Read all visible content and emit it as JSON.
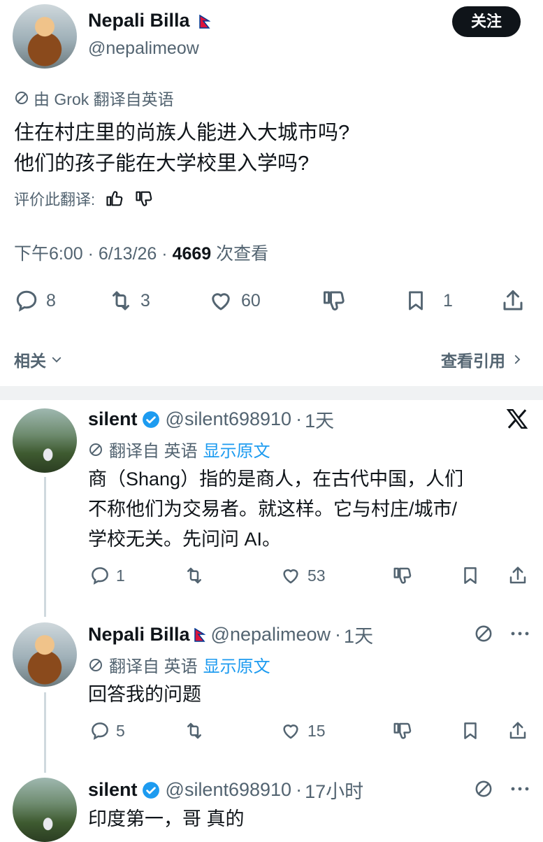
{
  "main_tweet": {
    "author_name": "Nepali Billa",
    "author_handle": "@nepalimeow",
    "follow_label": "关注",
    "translation_note": "由 Grok 翻译自英语",
    "body_line1": "住在村庄里的尚族人能进入大城市吗?",
    "body_line2": "他们的孩子能在大学校里入学吗?",
    "rate_translation": "评价此翻译:",
    "time": "下午6:00",
    "date": "6/13/26",
    "views": "4669",
    "views_label": "次查看",
    "replies": "8",
    "retweets": "3",
    "likes": "60",
    "bookmarks": "1"
  },
  "related_label": "相关",
  "view_quotes_label": "查看引用",
  "replies": [
    {
      "name": "silent",
      "handle": "@silent698910",
      "time": "1天",
      "translated_from": "翻译自 英语",
      "show_original": "显示原文",
      "body_lines": [
        "商（Shang）指的是商人，在古代中国，人们",
        "不称他们为交易者。就这样。它与村庄/城市/",
        "学校无关。先问问 AI。"
      ],
      "reply_count": "1",
      "retweet_count": "",
      "like_count": "53"
    },
    {
      "name": "Nepali Billa",
      "handle": "@nepalimeow",
      "time": "1天",
      "translated_from": "翻译自 英语",
      "show_original": "显示原文",
      "body_lines": [
        "回答我的问题"
      ],
      "reply_count": "5",
      "retweet_count": "",
      "like_count": "15"
    },
    {
      "name": "silent",
      "handle": "@silent698910",
      "time": "17小时",
      "body_lines": [
        "印度第一，哥 真的"
      ]
    }
  ],
  "colors": {
    "text": "#0f1419",
    "muted": "#536471",
    "link": "#1d9bf0",
    "verified": "#1d9bf0",
    "button_bg": "#0f1419"
  }
}
